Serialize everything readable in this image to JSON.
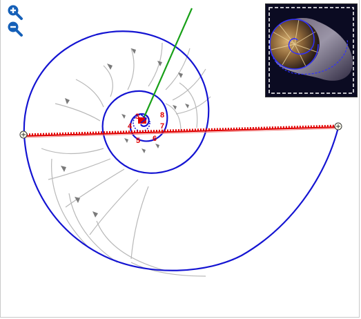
{
  "toolbar": {
    "zoom_in_icon": "zoom-in-icon",
    "zoom_out_icon": "zoom-out-icon"
  },
  "colors": {
    "spiral": "#1414d2",
    "measure_line": "#e00000",
    "pointer": "#18a018",
    "zoom_icon": "#1560b8",
    "label": "#e00000"
  },
  "spiral_labels": [
    "3",
    "8",
    "4",
    "5",
    "6",
    "7"
  ]
}
